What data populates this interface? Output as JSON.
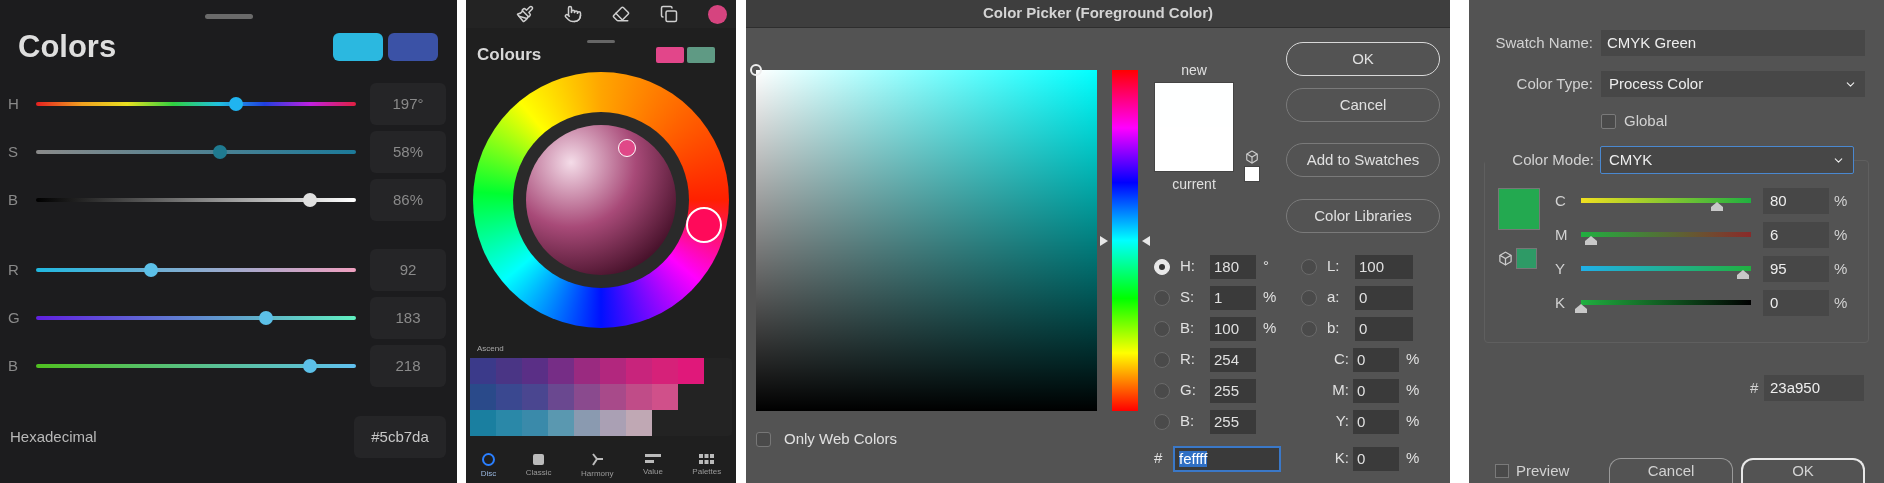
{
  "procreate_classic": {
    "title": "Colors",
    "swatches": [
      {
        "color": "#2bb8e0"
      },
      {
        "color": "#3b52a6"
      }
    ],
    "slider_groups": [
      {
        "sliders": [
          {
            "label": "H",
            "level": 0.625,
            "value": "197°"
          },
          {
            "label": "S",
            "level": 0.575,
            "value": "58%"
          },
          {
            "label": "B",
            "level": 0.856,
            "value": "86%"
          }
        ]
      },
      {
        "sliders": [
          {
            "label": "R",
            "level": 0.36,
            "value": "92"
          },
          {
            "label": "G",
            "level": 0.72,
            "value": "183"
          },
          {
            "label": "B",
            "level": 0.856,
            "value": "218"
          }
        ]
      }
    ],
    "hex_label": "Hexadecimal",
    "hex_value": "#5cb7da"
  },
  "procreate_disc": {
    "current_color": {
      "color": "#d6447f"
    },
    "title": "Colours",
    "swatches": [
      {
        "color": "#e2468a"
      },
      {
        "color": "#5f9a84"
      }
    ],
    "palette_title": "Ascend",
    "palette_rows": [
      {
        "swatches": [
          {
            "color": "#3b3a8a"
          },
          {
            "color": "#4a3585"
          },
          {
            "color": "#5a2f86"
          },
          {
            "color": "#762d86"
          },
          {
            "color": "#9a2a80"
          },
          {
            "color": "#b2277e"
          },
          {
            "color": "#c8247c"
          },
          {
            "color": "#d62179"
          },
          {
            "color": "#e0187a"
          }
        ]
      },
      {
        "swatches": [
          {
            "color": "#2a4a8a"
          },
          {
            "color": "#3a4890"
          },
          {
            "color": "#4a4690"
          },
          {
            "color": "#6a4890"
          },
          {
            "color": "#8a4a8e"
          },
          {
            "color": "#a84a8a"
          },
          {
            "color": "#c04c88"
          },
          {
            "color": "#d0508a"
          }
        ]
      },
      {
        "swatches": [
          {
            "color": "#1a7fa0"
          },
          {
            "color": "#2a88a8"
          },
          {
            "color": "#3a8aaa"
          },
          {
            "color": "#5a98b0"
          },
          {
            "color": "#8a9ab0"
          },
          {
            "color": "#aaa0b4"
          },
          {
            "color": "#c0a8b4"
          }
        ]
      }
    ],
    "tabs": [
      {
        "label": "Disc",
        "selected": true
      },
      {
        "label": "Classic",
        "selected": false
      },
      {
        "label": "Harmony",
        "selected": false
      },
      {
        "label": "Value",
        "selected": false
      },
      {
        "label": "Palettes",
        "selected": false
      }
    ]
  },
  "photoshop_picker": {
    "title": "Color Picker (Foreground Color)",
    "hue": {
      "level": 0.5
    },
    "preview": [
      {
        "label": "new",
        "color": "#feffff"
      },
      {
        "label": "current",
        "color": "#ffffff"
      }
    ],
    "buttons": [
      {
        "label": "OK",
        "default": true
      },
      {
        "label": "Cancel",
        "default": false
      },
      {
        "label": "Add to Swatches",
        "default": false
      },
      {
        "label": "Color Libraries",
        "default": false
      }
    ],
    "hsb_rgb_fields": [
      {
        "label": "H:",
        "value": "180",
        "unit": "°",
        "selected": true
      },
      {
        "label": "S:",
        "value": "1",
        "unit": "%",
        "selected": false
      },
      {
        "label": "B:",
        "value": "100",
        "unit": "%",
        "selected": false
      },
      {
        "label": "R:",
        "value": "254",
        "selected": false
      },
      {
        "label": "G:",
        "value": "255",
        "selected": false
      },
      {
        "label": "B:",
        "value": "255",
        "selected": false
      }
    ],
    "lab_fields": [
      {
        "label": "L:",
        "value": "100",
        "selected": false
      },
      {
        "label": "a:",
        "value": "0",
        "selected": false
      },
      {
        "label": "b:",
        "value": "0",
        "selected": false
      }
    ],
    "cmyk_fields": [
      {
        "label": "C:",
        "value": "0",
        "unit": "%"
      },
      {
        "label": "M:",
        "value": "0",
        "unit": "%"
      },
      {
        "label": "Y:",
        "value": "0",
        "unit": "%"
      },
      {
        "label": "K:",
        "value": "0",
        "unit": "%"
      }
    ],
    "hex": {
      "label": "#",
      "value": "feffff",
      "highlighted": true
    },
    "web_colors": {
      "label": "Only Web Colors",
      "checked": false
    }
  },
  "illustrator_swatch": {
    "swatch_name": {
      "label": "Swatch Name:",
      "value": "CMYK Green"
    },
    "color_type": {
      "label": "Color Type:",
      "value": "Process Color"
    },
    "global": {
      "label": "Global",
      "checked": false
    },
    "color_mode": {
      "label": "Color Mode:",
      "value": "CMYK"
    },
    "swatches": [
      {
        "color": "#23a950"
      },
      {
        "color": "#2e9a66"
      }
    ],
    "sliders": [
      {
        "label": "C",
        "level": 0.8,
        "value": "80",
        "unit": "%"
      },
      {
        "label": "M",
        "level": 0.06,
        "value": "6",
        "unit": "%"
      },
      {
        "label": "Y",
        "level": 0.95,
        "value": "95",
        "unit": "%"
      },
      {
        "label": "K",
        "level": 0,
        "value": "0",
        "unit": "%"
      }
    ],
    "hex": {
      "label": "#",
      "value": "23a950"
    },
    "preview": {
      "label": "Preview",
      "checked": false
    },
    "buttons": [
      {
        "label": "Cancel",
        "default": false
      },
      {
        "label": "OK",
        "default": true
      }
    ]
  }
}
